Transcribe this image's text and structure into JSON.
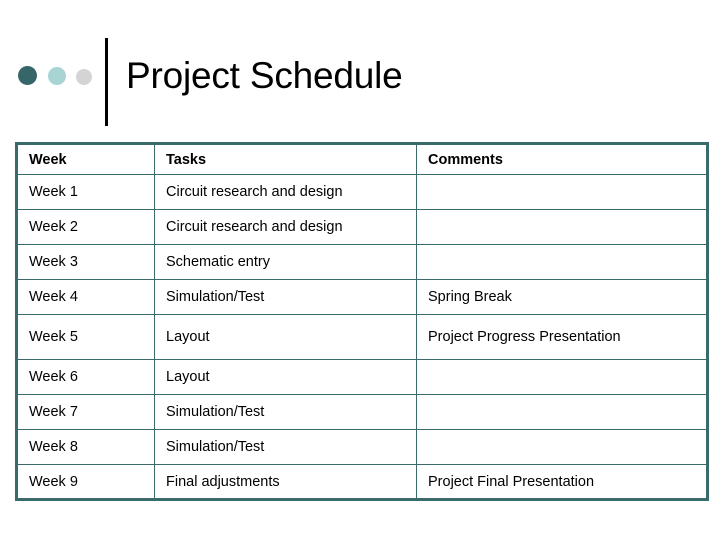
{
  "slide": {
    "title": "Project Schedule",
    "background_color": "#ffffff",
    "accent_color": "#3a6b6b",
    "decor_dots": [
      {
        "name": "dot-dark-teal",
        "color": "#36666a"
      },
      {
        "name": "dot-light-teal",
        "color": "#a8d4d4"
      },
      {
        "name": "dot-light-gray",
        "color": "#d4d4d4"
      }
    ]
  },
  "table": {
    "border_color": "#3a6b6b",
    "headers": [
      "Week",
      "Tasks",
      "Comments"
    ],
    "rows": [
      {
        "week": "Week 1",
        "task": "Circuit research and design",
        "comment": ""
      },
      {
        "week": "Week 2",
        "task": "Circuit research and design",
        "comment": ""
      },
      {
        "week": "Week 3",
        "task": "Schematic entry",
        "comment": ""
      },
      {
        "week": "Week 4",
        "task": "Simulation/Test",
        "comment": "Spring Break"
      },
      {
        "week": "Week 5",
        "task": "Layout",
        "comment": "Project Progress Presentation"
      },
      {
        "week": "Week 6",
        "task": "Layout",
        "comment": ""
      },
      {
        "week": "Week 7",
        "task": "Simulation/Test",
        "comment": ""
      },
      {
        "week": "Week 8",
        "task": "Simulation/Test",
        "comment": ""
      },
      {
        "week": "Week 9",
        "task": "Final adjustments",
        "comment": "Project Final Presentation"
      }
    ]
  }
}
